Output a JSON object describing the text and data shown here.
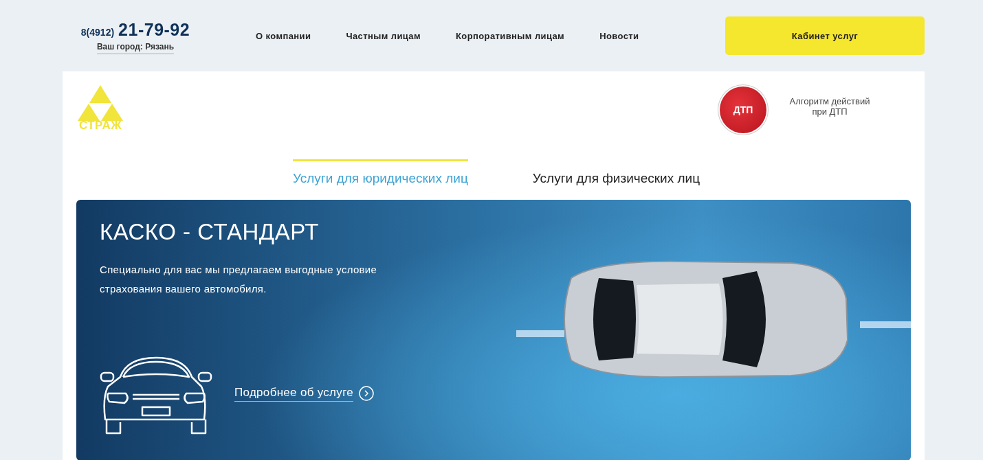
{
  "header": {
    "phone_prefix": "8(4912)",
    "phone": "21-79-92",
    "city": "Ваш город: Рязань",
    "nav": [
      "О компании",
      "Частным лицам",
      "Корпоративным лицам",
      "Новости"
    ],
    "cabinet_button": "Кабинет услуг"
  },
  "logo": {
    "text": "СТРАЖ"
  },
  "dtp": {
    "badge": "ДТП",
    "text": "Алгоритм действий\nпри ДТП"
  },
  "tabs": [
    {
      "label": "Услуги для юридических лиц",
      "selected": true
    },
    {
      "label": "Услуги для физических лиц",
      "selected": false
    }
  ],
  "banner": {
    "title": "КАСКО - СТАНДАРТ",
    "description": "Специально для вас мы предлагаем выгодные условие страхования вашего автомобиля.",
    "link": "Подробнее об услуге"
  }
}
